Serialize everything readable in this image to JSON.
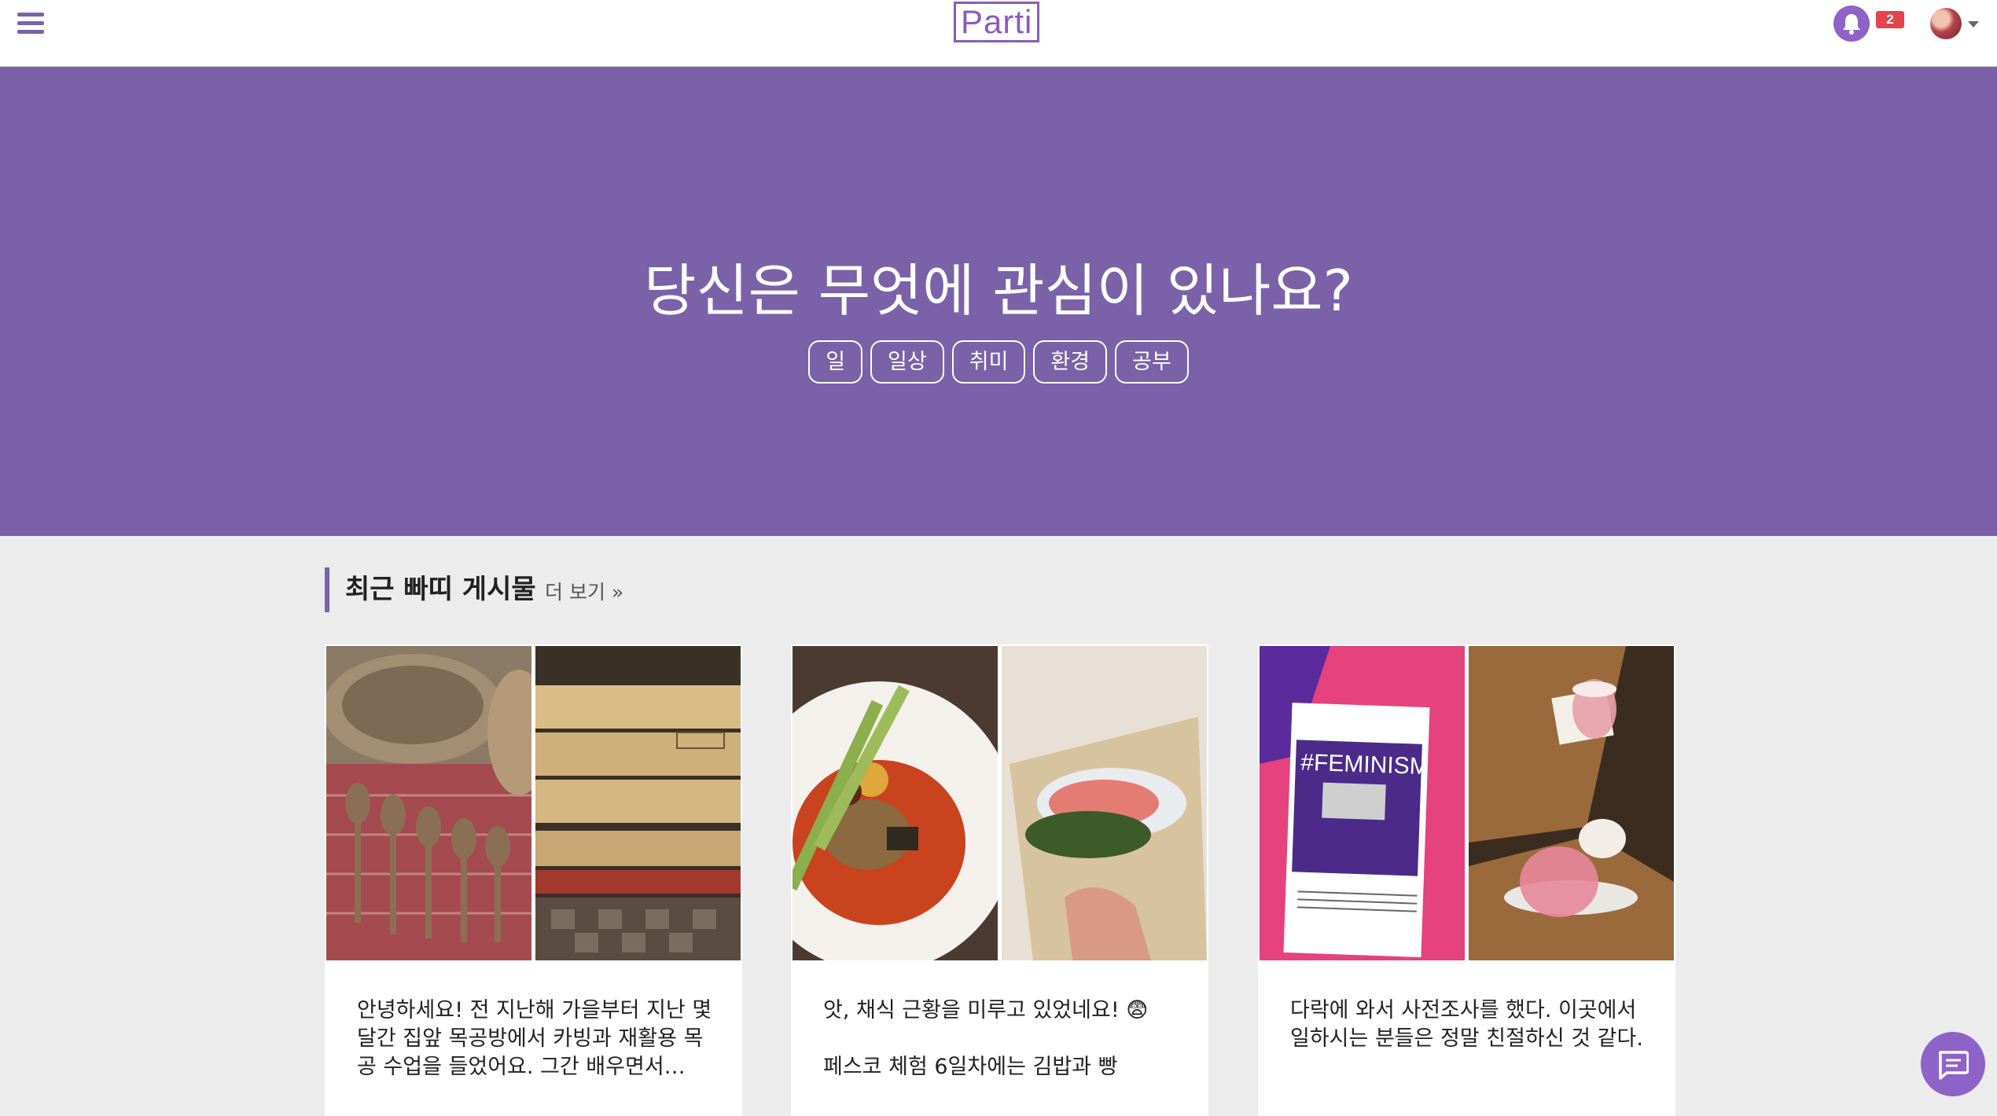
{
  "header": {
    "logo": "Parti",
    "notification_count": "2"
  },
  "hero": {
    "title": "당신은 무엇에 관심이 있나요?",
    "tags": [
      "일",
      "일상",
      "취미",
      "환경",
      "공부"
    ]
  },
  "section": {
    "title": "최근 빠띠 게시물",
    "more": "더 보기 »"
  },
  "posts": [
    {
      "text": "안녕하세요! 전 지난해 가을부터 지난 몇달간 집앞 목공방에서 카빙과 재활용 목공 수업을 들었어요. 그간 배우면서…"
    },
    {
      "text": "앗, 채식 근황을 미루고 있었네요! 😨\n\n페스코 체험 6일차에는 김밥과 빵"
    },
    {
      "text": "다락에 와서 사전조사를 했다. 이곳에서 일하시는 분들은 정말 친절하신 것 같다."
    }
  ],
  "colors": {
    "accent": "#7a61a8",
    "badge": "#e5444d",
    "background": "#ececec"
  },
  "icons": [
    "menu-icon",
    "bell-icon",
    "caret-down-icon",
    "chat-icon"
  ]
}
